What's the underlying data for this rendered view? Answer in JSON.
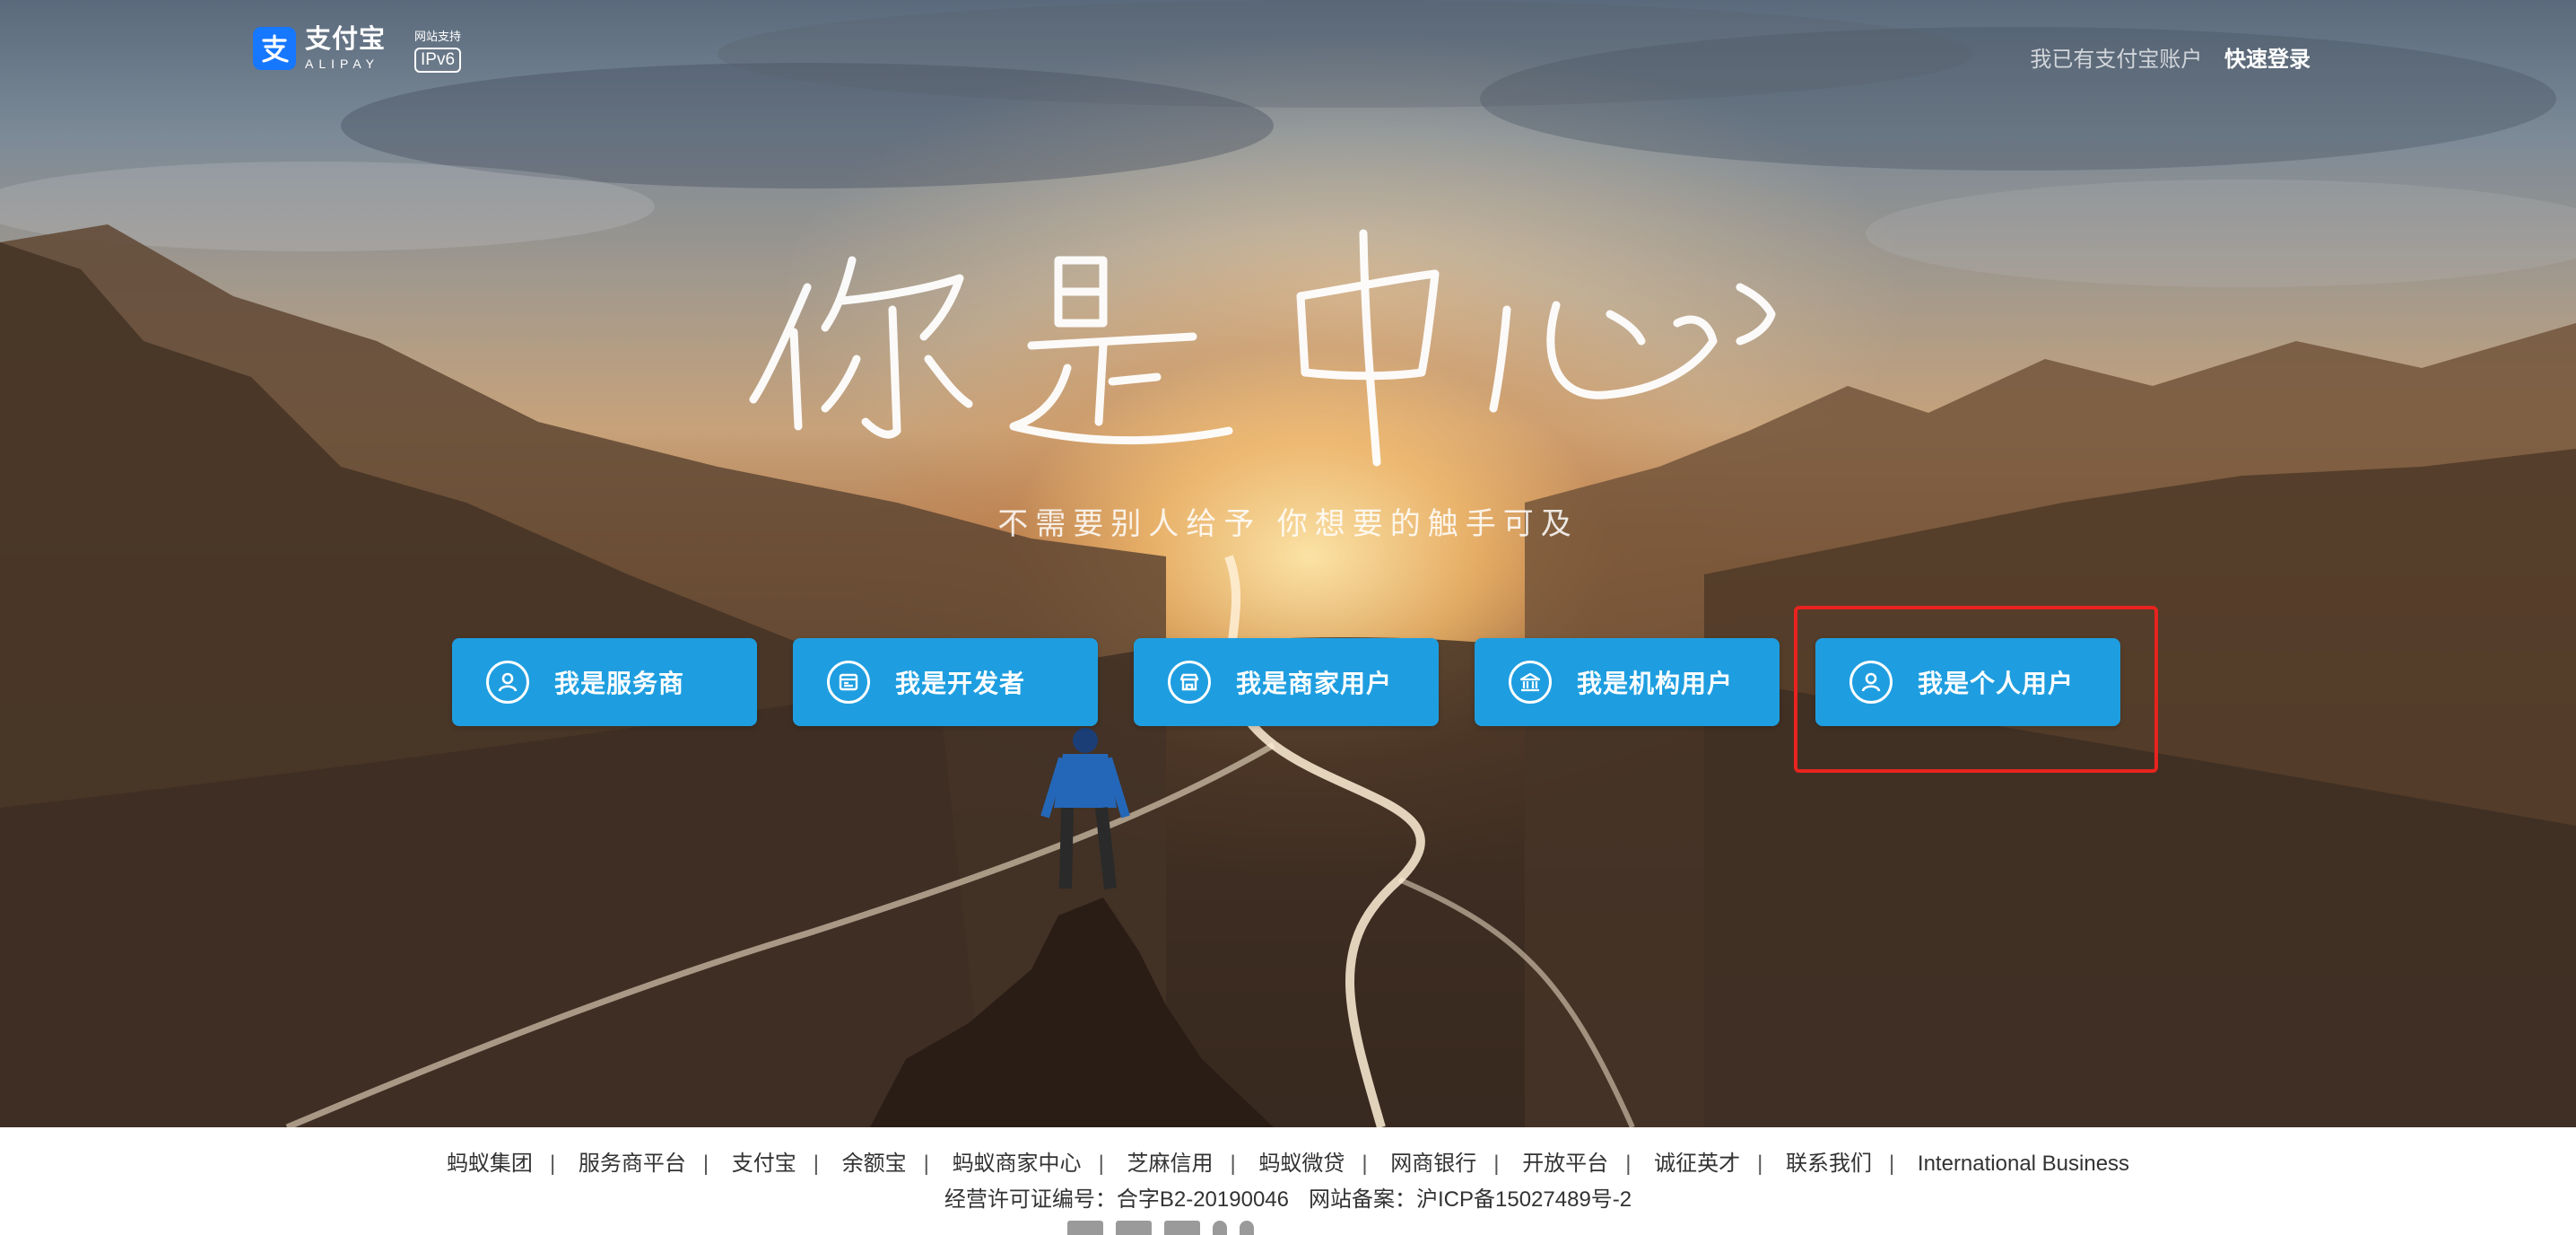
{
  "header": {
    "logo_cn": "支付宝",
    "logo_en": "ALIPAY",
    "ipv6_label": "网站支持",
    "ipv6_badge": "IPv6",
    "login_prompt": "我已有支付宝账户",
    "login_link": "快速登录"
  },
  "hero": {
    "title": "你是中心",
    "subtitle": "不需要别人给予 你想要的触手可及"
  },
  "roles": [
    {
      "label": "我是服务商",
      "icon": "person-circle-icon"
    },
    {
      "label": "我是开发者",
      "icon": "browser-window-icon"
    },
    {
      "label": "我是商家用户",
      "icon": "storefront-icon"
    },
    {
      "label": "我是机构用户",
      "icon": "bank-building-icon"
    },
    {
      "label": "我是个人用户",
      "icon": "person-circle-icon"
    }
  ],
  "colors": {
    "button_bg": "#1e9ee0",
    "highlight": "#e8231f",
    "brand": "#1677ff"
  },
  "footer": {
    "links": [
      "蚂蚁集团",
      "服务商平台",
      "支付宝",
      "余额宝",
      "蚂蚁商家中心",
      "芝麻信用",
      "蚂蚁微贷",
      "网商银行",
      "开放平台",
      "诚征英才",
      "联系我们",
      "International Business"
    ],
    "license": "经营许可证编号：合字B2-20190046",
    "icp": "网站备案：沪ICP备15027489号-2"
  }
}
